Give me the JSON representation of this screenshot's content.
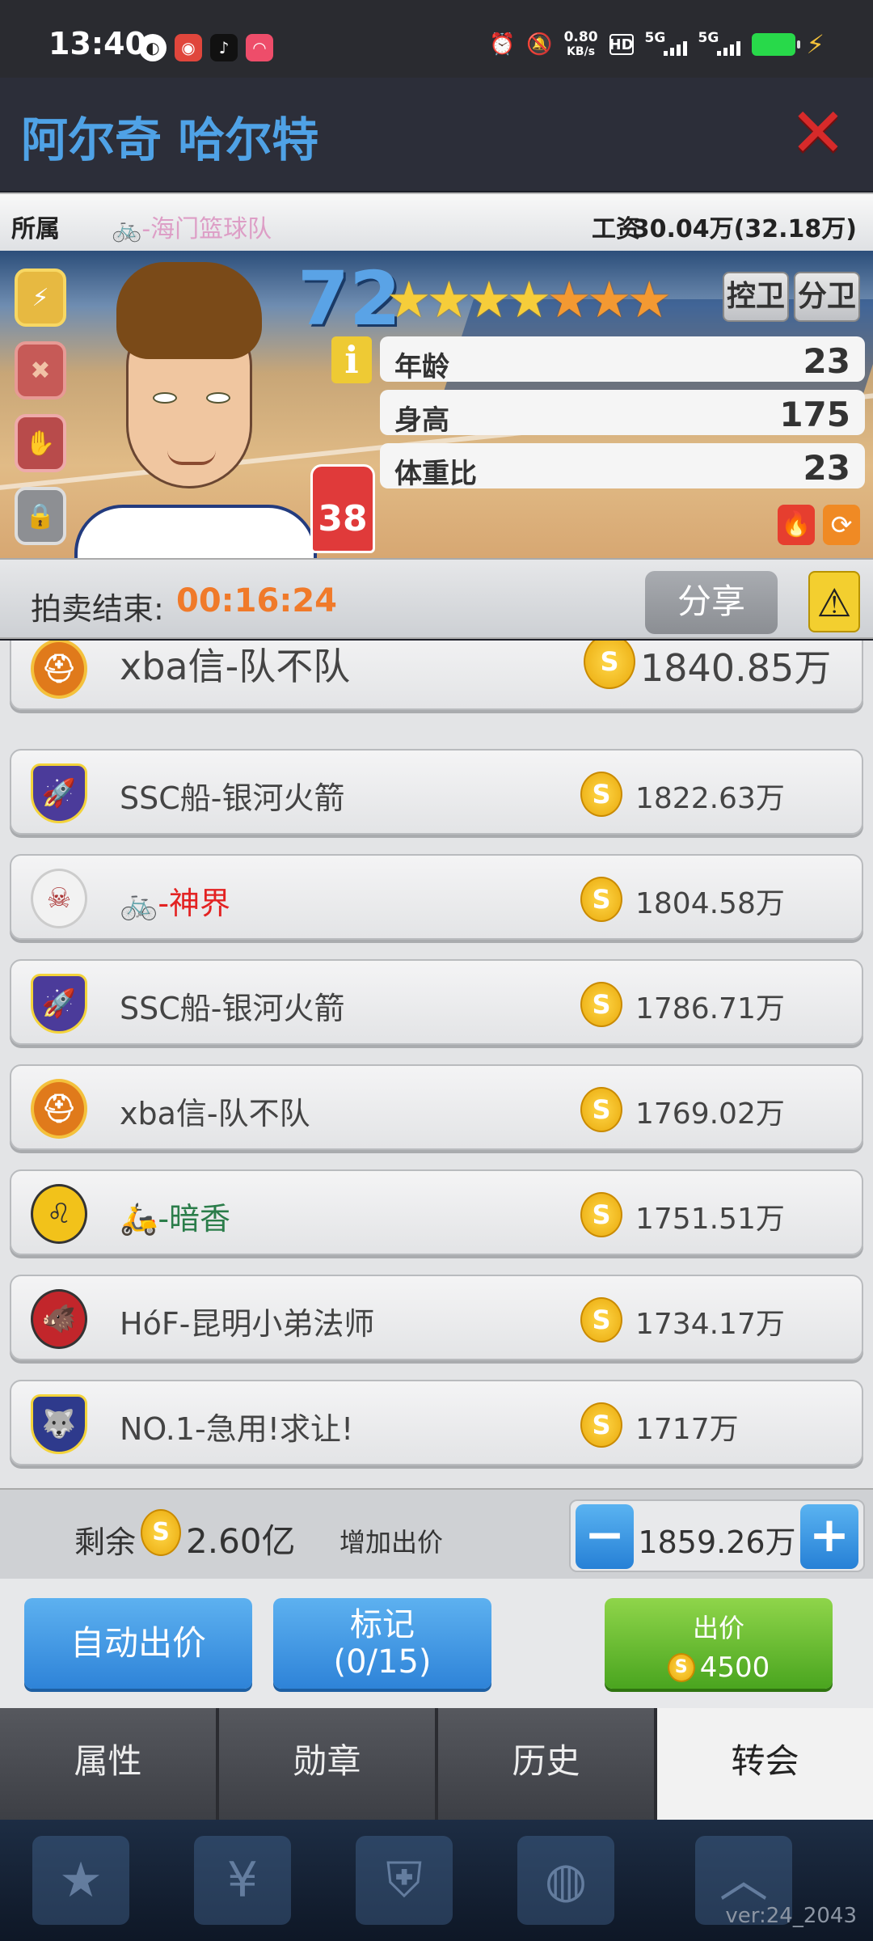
{
  "status_bar": {
    "time": "13:40",
    "speed_top": "0.80",
    "speed_bottom": "KB/s",
    "net1": "5G",
    "net2": "5G"
  },
  "header": {
    "title": "阿尔奇 哈尔特"
  },
  "affiliation": {
    "label": "所属",
    "team_prefix_icon": "bicycle-icon",
    "team": "-海门篮球队",
    "salary_label": "工资",
    "salary": "30.04万(32.18万)"
  },
  "player": {
    "rating": "72",
    "stars_gold": "★★★★",
    "stars_orange": "★★★",
    "positions": [
      "控卫",
      "分卫"
    ],
    "jersey_number": "38",
    "attributes": [
      {
        "key": "年龄",
        "value": "23"
      },
      {
        "key": "身高",
        "value": "175"
      },
      {
        "key": "体重比",
        "value": "23"
      }
    ]
  },
  "auction": {
    "label": "拍卖结束:",
    "timer": "00:16:24",
    "share_label": "分享"
  },
  "bids": [
    {
      "team": "xba信-队不队",
      "amount": "1840.85万",
      "logo_color": "#e07a1b",
      "logo_icon": "spartan-helmet-icon"
    },
    {
      "team": "SSC船-银河火箭",
      "amount": "1822.63万",
      "logo_color": "#4b3b9a",
      "logo_icon": "rocket-shield-icon"
    },
    {
      "team_prefix": "🚲",
      "team": "-神界",
      "amount": "1804.58万",
      "logo_color": "#eeeeee",
      "logo_icon": "viking-icon",
      "name_style": "red"
    },
    {
      "team": "SSC船-银河火箭",
      "amount": "1786.71万",
      "logo_color": "#4b3b9a",
      "logo_icon": "rocket-shield-icon"
    },
    {
      "team": "xba信-队不队",
      "amount": "1769.02万",
      "logo_color": "#e07a1b",
      "logo_icon": "spartan-helmet-icon"
    },
    {
      "team_prefix": "🛵",
      "team": "-暗香",
      "amount": "1751.51万",
      "logo_color": "#f2c21a",
      "logo_icon": "lion-icon",
      "name_style": "green"
    },
    {
      "team": "HóF-昆明小弟法师",
      "amount": "1734.17万",
      "logo_color": "#c2262b",
      "logo_icon": "boar-icon"
    },
    {
      "team": "NO.1-急用!求让!",
      "amount": "1717万",
      "logo_color": "#2e3a8c",
      "logo_icon": "wolf-shield-icon"
    }
  ],
  "controls": {
    "remaining_label": "剩余",
    "remaining_amount": "2.60亿",
    "increase_label": "增加出价",
    "bid_value": "1859.26万"
  },
  "actions": {
    "auto_bid": "自动出价",
    "mark_line1": "标记",
    "mark_line2": "(0/15)",
    "bid_label": "出价",
    "bid_cost": "4500"
  },
  "tabs": [
    "属性",
    "勋章",
    "历史",
    "转会"
  ],
  "active_tab": "转会",
  "version": "ver:24_2043"
}
